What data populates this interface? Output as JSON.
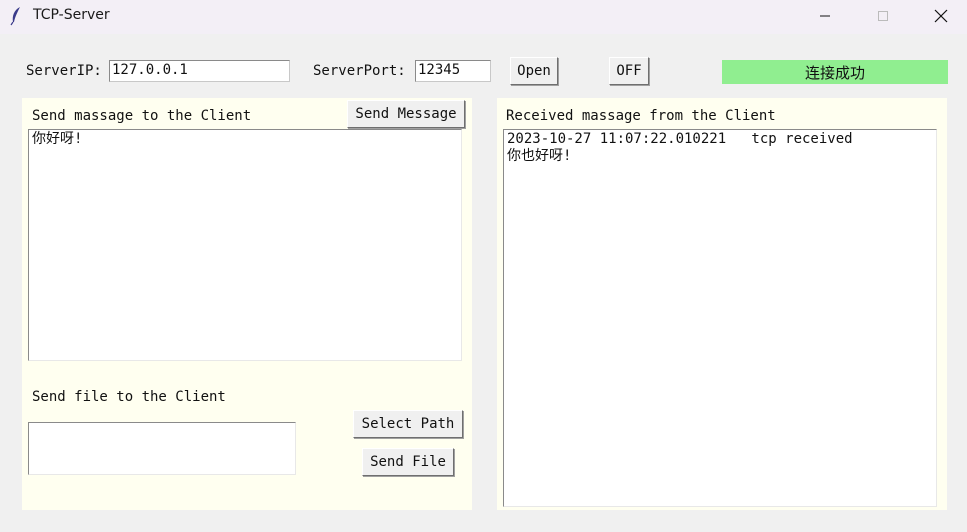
{
  "window": {
    "title": "TCP-Server",
    "icon": "feather-icon",
    "controls": [
      "minimize-icon",
      "maximize-icon",
      "close-icon"
    ]
  },
  "connection": {
    "ip_label": "ServerIP:",
    "ip_value": "127.0.0.1",
    "port_label": "ServerPort:",
    "port_value": "12345",
    "open_label": "Open",
    "off_label": "OFF",
    "status_text": "连接成功",
    "status_color": "#90ee90"
  },
  "send_panel": {
    "message_label": "Send massage to the Client",
    "send_message_button": "Send Message",
    "message_text": "你好呀!",
    "file_label": "Send file to the Client",
    "file_path_value": "",
    "select_path_button": "Select Path",
    "send_file_button": "Send File",
    "panel_color": "#fffff0"
  },
  "receive_panel": {
    "label": "Received massage from the Client",
    "log_text": "2023-10-27 11:07:22.010221   tcp received\n你也好呀!"
  }
}
